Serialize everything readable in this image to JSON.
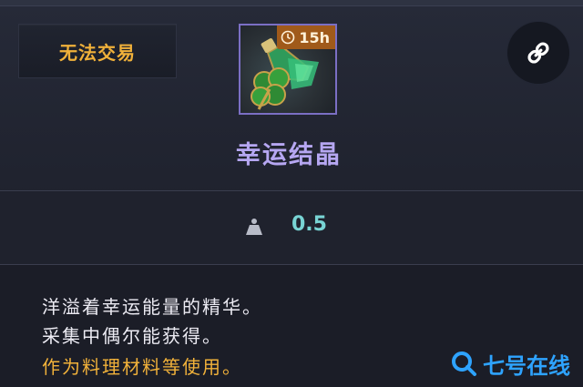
{
  "header": {
    "trade_label": "无法交易",
    "timer_text": "15h",
    "item_name": "幸运结晶"
  },
  "icons": {
    "link": "link-icon",
    "weight": "weight-icon",
    "clock": "clock-icon"
  },
  "weight": {
    "value": "0.5"
  },
  "description": {
    "line1": "洋溢着幸运能量的精华。",
    "line2": "采集中偶尔能获得。",
    "line3": "作为料理材料等使用。"
  },
  "watermark": {
    "text": "七号在线"
  },
  "colors": {
    "trade_text": "#f0b13a",
    "item_name": "#b6a7f2",
    "weight_value": "#78d4d4",
    "usage_text": "#f2b23a",
    "icon_border": "#7b6fc4"
  }
}
